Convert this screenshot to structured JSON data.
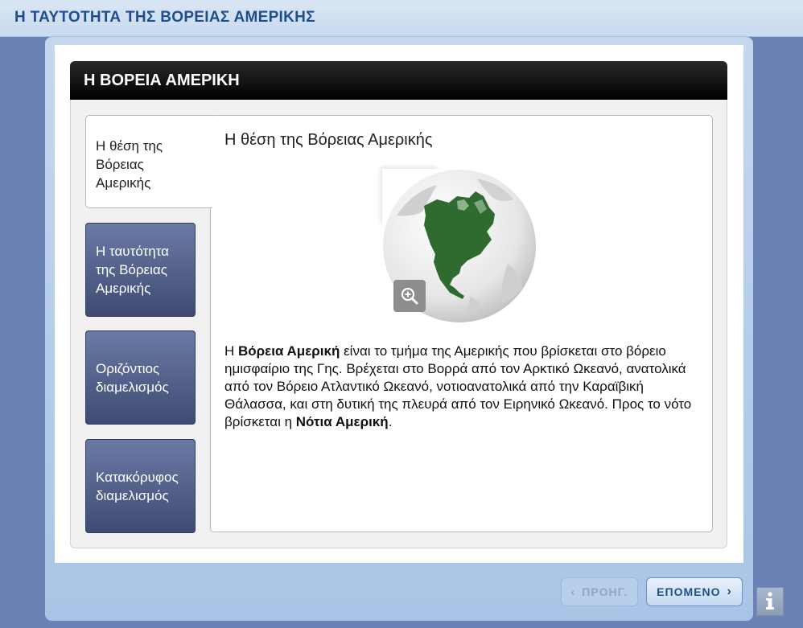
{
  "app": {
    "title": "Η ΤΑΥΤΟΤΗΤΑ ΤΗΣ ΒΟΡΕΙΑΣ ΑΜΕΡΙΚΗΣ"
  },
  "card": {
    "title": "Η ΒΟΡΕΙΑ ΑΜΕΡΙΚΗ"
  },
  "tabs": [
    {
      "label": "Η θέση της Βόρειας Αμερικής",
      "active": true
    },
    {
      "label": "Η ταυτότητα της Βόρειας Αμερικής",
      "active": false
    },
    {
      "label": "Οριζόντιος διαμελισμός",
      "active": false
    },
    {
      "label": "Κατακόρυφος διαμελισμός",
      "active": false
    }
  ],
  "content": {
    "heading": "Η θέση της Βόρειας Αμερικής",
    "image": {
      "icon": "globe-north-america",
      "zoom_icon": "zoom-in-icon"
    },
    "paragraph": {
      "p1": "Η ",
      "b1": "Βόρεια Αμερική",
      "p2": " είναι το τμήμα της Αμερικής που βρίσκεται στο βόρειο ημισφαίριο της Γης. Βρέχεται στο Βορρά από τον Αρκτικό Ωκεανό, ανατολικά από τον Βόρειο Ατλαντικό Ωκεανό, νοτιοανατολικά από την Καραϊβική Θάλασσα, και στη δυτική της πλευρά από τον Ειρηνικό Ωκεανό. Προς το νότο βρίσκεται η ",
      "b2": "Νότια Αμερική",
      "p3": "."
    }
  },
  "nav": {
    "prev_label": "ΠΡΟΗΓ.",
    "next_label": "ΕΠΟΜΕΝΟ",
    "prev_enabled": false
  },
  "colors": {
    "title_blue": "#1f4e8c",
    "globe_land": "#2f6b2f",
    "tab_button": "#4a567e"
  }
}
